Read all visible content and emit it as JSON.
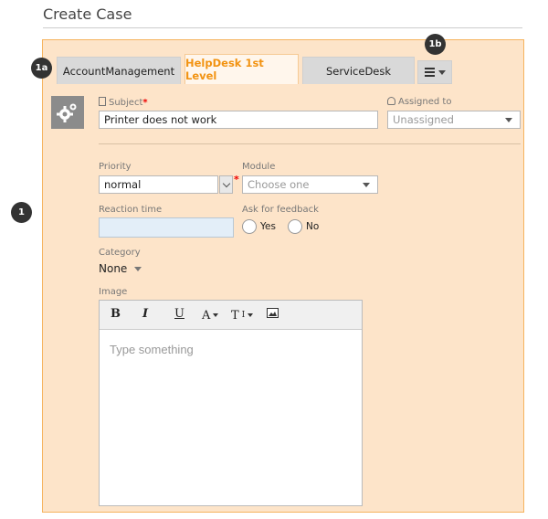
{
  "page": {
    "title": "Create Case"
  },
  "callouts": {
    "main": "1",
    "tabs": "1a",
    "menu": "1b"
  },
  "tabs": [
    {
      "label": "AccountManagement",
      "active": false
    },
    {
      "label": "HelpDesk 1st Level",
      "active": true
    },
    {
      "label": "ServiceDesk",
      "active": false
    }
  ],
  "form": {
    "subject": {
      "label": "Subject",
      "required_mark": "*",
      "value": "Printer does not work",
      "icon": "document-icon"
    },
    "assigned_to": {
      "label": "Assigned to",
      "value": "Unassigned",
      "icon": "user-icon"
    },
    "priority": {
      "label": "Priority",
      "value": "normal",
      "required_mark": "*"
    },
    "module": {
      "label": "Module",
      "placeholder": "Choose one"
    },
    "reaction_time": {
      "label": "Reaction time",
      "value": ""
    },
    "feedback": {
      "label": "Ask for feedback",
      "options": [
        "Yes",
        "No"
      ]
    },
    "category": {
      "label": "Category",
      "value": "None"
    },
    "image": {
      "label": "Image"
    }
  },
  "editor": {
    "toolbar": {
      "bold": "B",
      "italic": "I",
      "underline": "U",
      "font_color": "A",
      "text_size": "T",
      "image": "image-icon"
    },
    "placeholder": "Type something"
  },
  "colors": {
    "panel_bg": "#fde4c9",
    "panel_border": "#f6b35e",
    "active_tab_text": "#f29312",
    "required": "#e00000"
  }
}
